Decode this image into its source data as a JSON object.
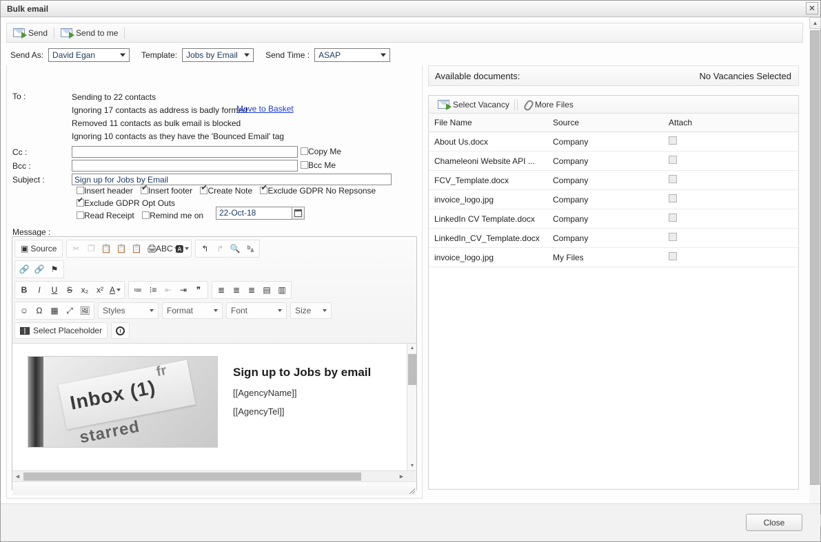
{
  "window": {
    "title": "Bulk email",
    "close_icon": "close-icon"
  },
  "toolbar": {
    "send_label": "Send",
    "send_to_me_label": "Send to me",
    "send_icon": "envelope-send-icon"
  },
  "fields": {
    "send_as_label": "Send As:",
    "send_as_value": "David Egan",
    "template_label": "Template:",
    "template_value": "Jobs by Email",
    "send_time_label": "Send Time :",
    "send_time_value": "ASAP"
  },
  "form": {
    "to_label": "To :",
    "to_lines": [
      "Sending to 22 contacts",
      "Ignoring 17 contacts as address is badly formed",
      "Removed 11 contacts as bulk email is blocked",
      "Ignoring 10 contacts as they have the 'Bounced Email' tag"
    ],
    "move_to_basket": "Move to Basket",
    "cc_label": "Cc :",
    "cc_value": "",
    "cc_placeholder": "",
    "bcc_label": "Bcc :",
    "bcc_value": "",
    "bcc_placeholder": "",
    "copy_me_label": "Copy Me",
    "copy_me_checked": false,
    "bcc_me_label": "Bcc Me",
    "bcc_me_checked": false,
    "subject_label": "Subject :",
    "subject_value": "Sign up for Jobs by Email",
    "checkboxes": [
      {
        "label": "Insert header",
        "checked": false
      },
      {
        "label": "Insert footer",
        "checked": true
      },
      {
        "label": "Create Note",
        "checked": true
      },
      {
        "label": "Exclude GDPR No Repsonse",
        "checked": true
      },
      {
        "label": "Exclude GDPR Opt Outs",
        "checked": true
      },
      {
        "label": "Read Receipt",
        "checked": false
      },
      {
        "label": "Remind me on",
        "checked": false
      }
    ],
    "remind_date": "22-Oct-18",
    "calendar_icon": "calendar-icon",
    "message_label": "Message :"
  },
  "editor": {
    "source_label": "Source",
    "styles_label": "Styles",
    "format_label": "Format",
    "font_label": "Font",
    "size_label": "Size",
    "select_placeholder_label": "Select Placeholder",
    "placeholder_icon": "book-icon",
    "timer_icon": "clock-icon",
    "buttons_row1": [
      "cut-icon",
      "copy-icon",
      "paste-icon",
      "paste-text-icon",
      "paste-word-icon",
      "print-icon",
      "spellcheck-icon",
      "text-color-icon"
    ],
    "buttons_row1b": [
      "undo-icon",
      "redo-icon",
      "find-icon",
      "replace-icon"
    ],
    "buttons_row2": [
      "link-icon",
      "unlink-icon",
      "anchor-icon"
    ],
    "buttons_row3": [
      "bold-icon",
      "italic-icon",
      "underline-icon",
      "strikethrough-icon",
      "subscript-icon",
      "superscript-icon",
      "font-color-icon"
    ],
    "buttons_row3b": [
      "numbered-list-icon",
      "bulleted-list-icon",
      "outdent-icon",
      "indent-icon",
      "blockquote-icon"
    ],
    "buttons_row3c": [
      "align-left-icon",
      "align-center-icon",
      "align-right-icon",
      "justify-icon",
      "align-all-icon"
    ],
    "buttons_row4": [
      "smiley-icon",
      "special-char-icon",
      "table-icon",
      "maximize-icon",
      "image-icon"
    ]
  },
  "preview": {
    "heading": "Sign up to Jobs by email",
    "line1": "[[AgencyName]]",
    "line2": "[[AgencyTel]]",
    "image_alt": "inbox-photo",
    "image_word": "Inbox (1)",
    "image_word2": "starred",
    "image_word3": "fr"
  },
  "documents": {
    "available_label": "Available documents:",
    "vacancy_status": "No Vacancies Selected",
    "select_vacancy_label": "Select Vacancy",
    "more_files_label": "More Files",
    "select_vacancy_icon": "envelope-icon",
    "more_files_icon": "paperclip-icon",
    "columns": [
      "File Name",
      "Source",
      "Attach"
    ],
    "rows": [
      {
        "name": "About Us.docx",
        "source": "Company",
        "attached": false
      },
      {
        "name": "Chameleoni Website API ...",
        "source": "Company",
        "attached": false
      },
      {
        "name": "FCV_Template.docx",
        "source": "Company",
        "attached": false
      },
      {
        "name": "invoice_logo.jpg",
        "source": "Company",
        "attached": false
      },
      {
        "name": "LinkedIn CV Template.docx",
        "source": "Company",
        "attached": false
      },
      {
        "name": "LinkedIn_CV_Template.docx",
        "source": "Company",
        "attached": false
      },
      {
        "name": "invoice_logo.jpg",
        "source": "My Files",
        "attached": false
      }
    ]
  },
  "footer": {
    "close_label": "Close"
  }
}
